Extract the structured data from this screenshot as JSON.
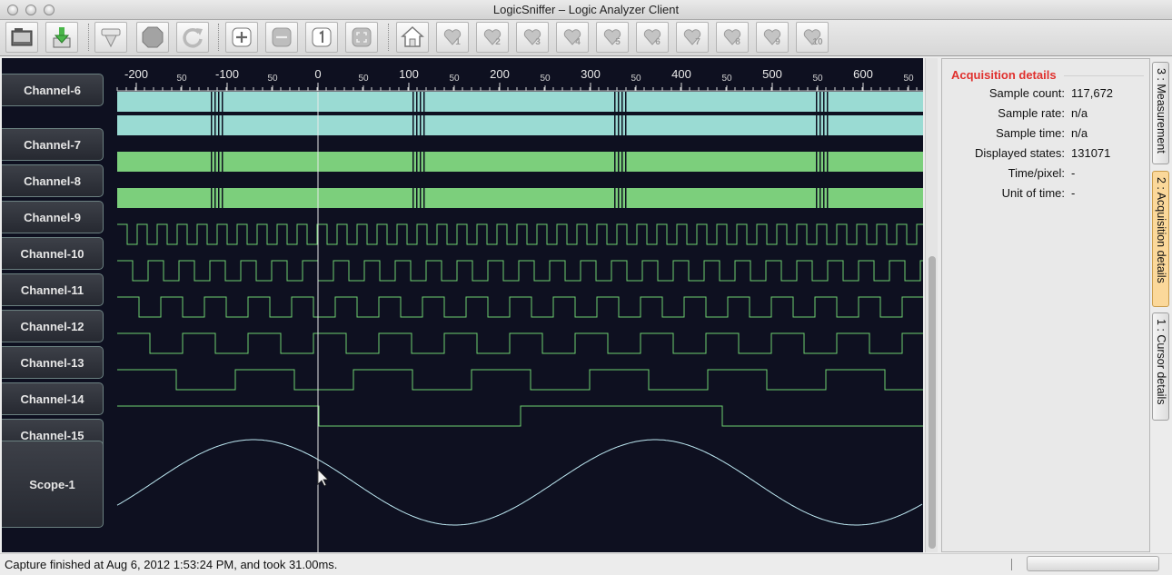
{
  "window": {
    "title": "LogicSniffer – Logic Analyzer Client"
  },
  "toolbar": {
    "buttons": [
      {
        "name": "open-project",
        "icon": "folder-icon"
      },
      {
        "name": "save-project",
        "icon": "download-icon"
      },
      {
        "name": "capture",
        "icon": "capture-icon"
      },
      {
        "name": "stop",
        "icon": "stop-icon"
      },
      {
        "name": "repeat-capture",
        "icon": "refresh-icon"
      },
      {
        "name": "zoom-in",
        "icon": "plus-icon"
      },
      {
        "name": "zoom-out",
        "icon": "minus-icon"
      },
      {
        "name": "zoom-original",
        "icon": "one-icon"
      },
      {
        "name": "zoom-fit",
        "icon": "fit-icon"
      },
      {
        "name": "goto-trigger",
        "icon": "home-icon"
      }
    ],
    "markers": [
      "1",
      "2",
      "3",
      "4",
      "5",
      "6",
      "7",
      "8",
      "9",
      "10"
    ]
  },
  "ruler": {
    "major": [
      "-200",
      "-100",
      "0",
      "100",
      "200",
      "300",
      "400",
      "500",
      "600"
    ],
    "minor": "50"
  },
  "channels": [
    {
      "label": "Channel-6",
      "color": "#9adbd3",
      "kind": "dense"
    },
    {
      "label": "Channel-7",
      "color": "#9adbd3",
      "kind": "dense"
    },
    {
      "label": "Channel-8",
      "color": "#7ccf7c",
      "kind": "dense"
    },
    {
      "label": "Channel-9",
      "color": "#7ccf7c",
      "kind": "dense"
    },
    {
      "label": "Channel-10",
      "color": "#6fd06f",
      "kind": "wave"
    },
    {
      "label": "Channel-11",
      "color": "#6fd06f",
      "kind": "wave"
    },
    {
      "label": "Channel-12",
      "color": "#6fd06f",
      "kind": "wave"
    },
    {
      "label": "Channel-13",
      "color": "#6fd06f",
      "kind": "wave"
    },
    {
      "label": "Channel-14",
      "color": "#6fd06f",
      "kind": "wave"
    },
    {
      "label": "Channel-15",
      "color": "#6fd06f",
      "kind": "wave"
    }
  ],
  "scope": {
    "label": "Scope-1",
    "color": "#bde8f2"
  },
  "details": {
    "title": "Acquisition details",
    "rows": [
      {
        "label": "Sample count:",
        "value": "117,672"
      },
      {
        "label": "Sample rate:",
        "value": "n/a"
      },
      {
        "label": "Sample time:",
        "value": "n/a"
      },
      {
        "label": "Displayed states:",
        "value": "131071"
      },
      {
        "label": "Time/pixel:",
        "value": "-"
      },
      {
        "label": "Unit of time:",
        "value": "-"
      }
    ]
  },
  "side_tabs": [
    {
      "label": "3 : Measurement",
      "active": false
    },
    {
      "label": "2 : Acquisition details",
      "active": true
    },
    {
      "label": "1 : Cursor details",
      "active": false
    }
  ],
  "status": {
    "text": "Capture finished at Aug 6, 2012 1:53:24 PM, and took 31.00ms."
  }
}
